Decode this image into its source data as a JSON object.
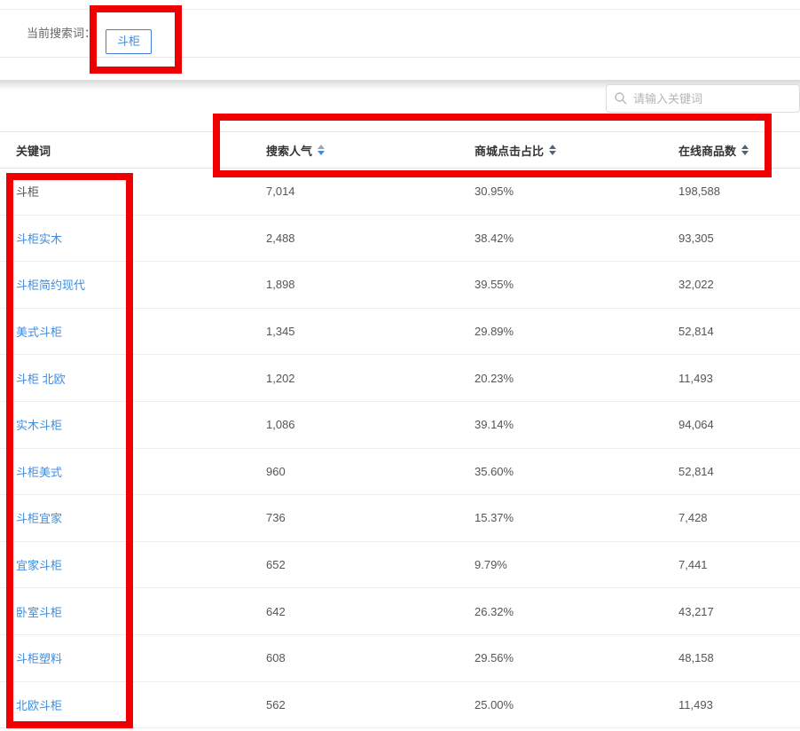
{
  "topbar": {
    "label": "当前搜索词：",
    "term": "斗柜"
  },
  "search": {
    "placeholder": "请输入关键词",
    "icon": "search-icon"
  },
  "table": {
    "columns": [
      {
        "label": "关键词",
        "sortable": false,
        "sort": "none"
      },
      {
        "label": "搜索人气",
        "sortable": true,
        "sort": "desc"
      },
      {
        "label": "商城点击占比",
        "sortable": true,
        "sort": "none"
      },
      {
        "label": "在线商品数",
        "sortable": true,
        "sort": "none"
      }
    ],
    "rows": [
      {
        "keyword": "斗柜",
        "link": false,
        "popularity": "7,014",
        "click_ratio": "30.95%",
        "products": "198,588"
      },
      {
        "keyword": "斗柜实木",
        "link": true,
        "popularity": "2,488",
        "click_ratio": "38.42%",
        "products": "93,305"
      },
      {
        "keyword": "斗柜简约现代",
        "link": true,
        "popularity": "1,898",
        "click_ratio": "39.55%",
        "products": "32,022"
      },
      {
        "keyword": "美式斗柜",
        "link": true,
        "popularity": "1,345",
        "click_ratio": "29.89%",
        "products": "52,814"
      },
      {
        "keyword": "斗柜 北欧",
        "link": true,
        "popularity": "1,202",
        "click_ratio": "20.23%",
        "products": "11,493"
      },
      {
        "keyword": "实木斗柜",
        "link": true,
        "popularity": "1,086",
        "click_ratio": "39.14%",
        "products": "94,064"
      },
      {
        "keyword": "斗柜美式",
        "link": true,
        "popularity": "960",
        "click_ratio": "35.60%",
        "products": "52,814"
      },
      {
        "keyword": "斗柜宜家",
        "link": true,
        "popularity": "736",
        "click_ratio": "15.37%",
        "products": "7,428"
      },
      {
        "keyword": "宜家斗柜",
        "link": true,
        "popularity": "652",
        "click_ratio": "9.79%",
        "products": "7,441"
      },
      {
        "keyword": "卧室斗柜",
        "link": true,
        "popularity": "642",
        "click_ratio": "26.32%",
        "products": "43,217"
      },
      {
        "keyword": "斗柜塑料",
        "link": true,
        "popularity": "608",
        "click_ratio": "29.56%",
        "products": "48,158"
      },
      {
        "keyword": "北欧斗柜",
        "link": true,
        "popularity": "562",
        "click_ratio": "25.00%",
        "products": "11,493"
      }
    ]
  },
  "colors": {
    "link_blue": "#3e8ddd",
    "tag_border_blue": "#3d7fd8",
    "sort_active_blue": "#3e8ddd",
    "annotation_red": "#ee0000"
  }
}
